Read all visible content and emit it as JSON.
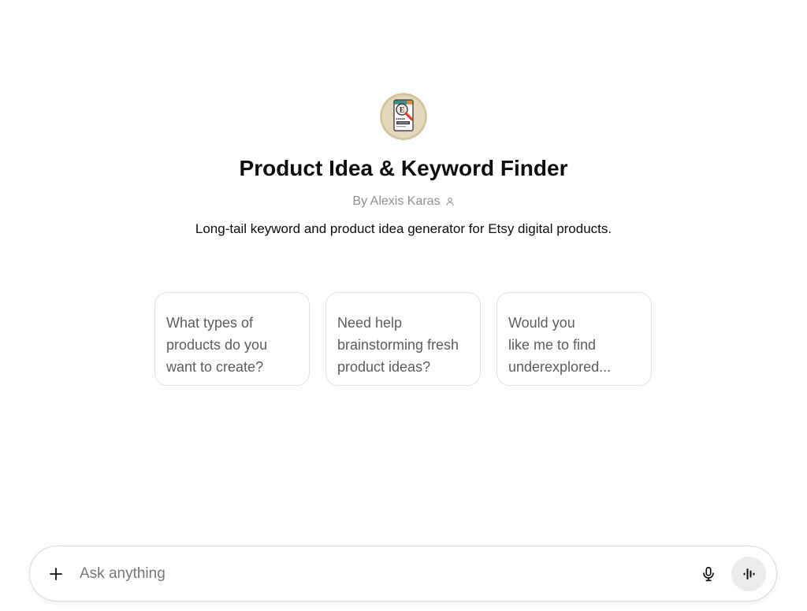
{
  "gpt": {
    "title": "Product Idea & Keyword Finder",
    "author": "By Alexis Karas",
    "author_icon": "person-icon",
    "description": "Long-tail keyword and product idea generator for Etsy digital products.",
    "logo": {
      "icon": "keyword-finder-logo",
      "lettering": "E"
    }
  },
  "suggestions": [
    {
      "lines": [
        "What types of",
        "products do you",
        "want to create?"
      ]
    },
    {
      "lines": [
        "Need help",
        "brainstorming fresh",
        "product ideas?"
      ]
    },
    {
      "lines": [
        "Would you",
        "like me to find",
        "underexplored..."
      ]
    }
  ],
  "composer": {
    "placeholder": "Ask anything",
    "add_icon": "plus-icon",
    "dictate_icon": "microphone-icon",
    "voice_icon": "voice-waveform-icon"
  },
  "colors": {
    "background": "#ffffff",
    "text_primary": "#0d0d0d",
    "text_secondary": "#5d5d5d",
    "text_muted": "#8f8f8f",
    "border": "#e3e3e3",
    "voice_button": "#ececec",
    "logo_badge": "#dccfae",
    "logo_handle": "#d9442b"
  }
}
